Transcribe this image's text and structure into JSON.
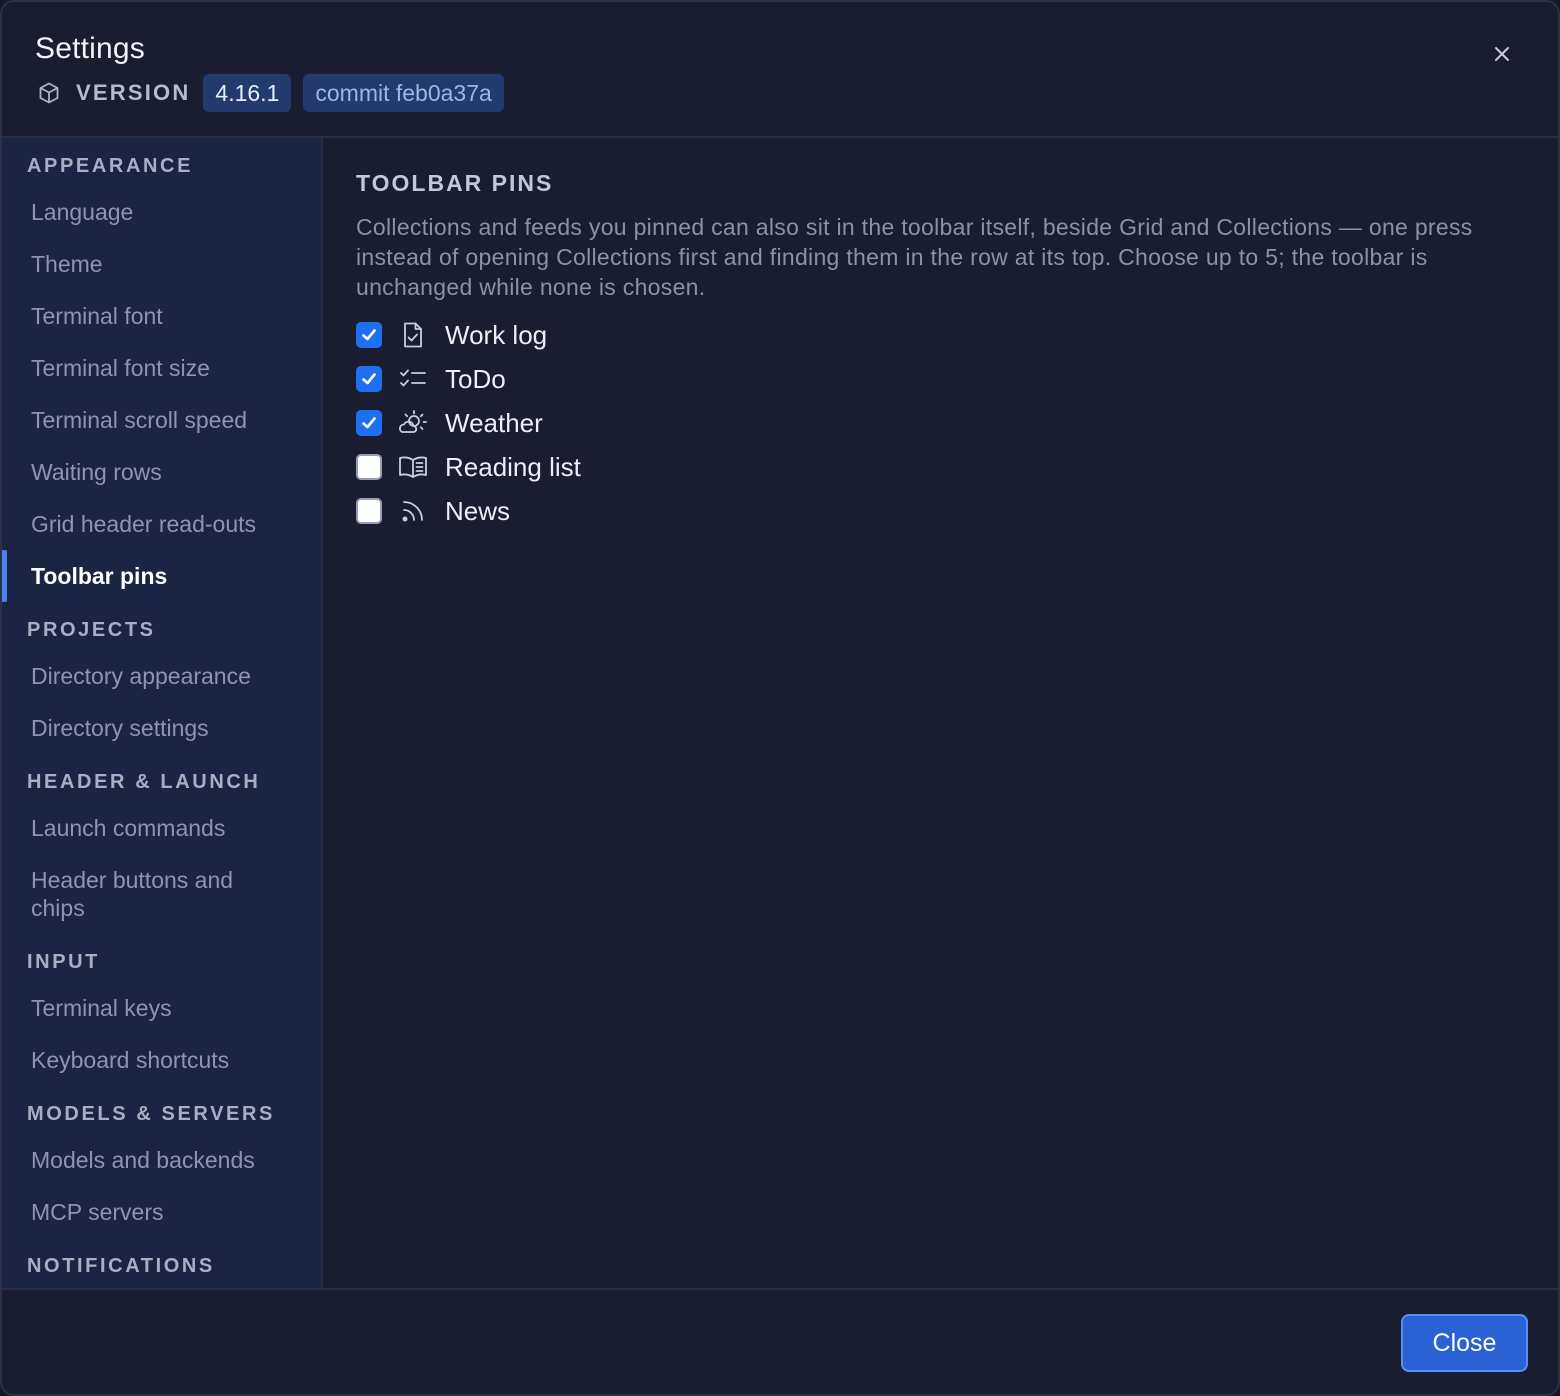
{
  "header": {
    "title": "Settings",
    "version_label": "VERSION",
    "version_chip": "4.16.1",
    "commit_chip": "commit feb0a37a"
  },
  "sidebar": {
    "sections": [
      {
        "header": "APPEARANCE",
        "items": [
          "Language",
          "Theme",
          "Terminal font",
          "Terminal font size",
          "Terminal scroll speed",
          "Waiting rows",
          "Grid header read-outs",
          "Toolbar pins"
        ]
      },
      {
        "header": "PROJECTS",
        "items": [
          "Directory appearance",
          "Directory settings"
        ]
      },
      {
        "header": "HEADER & LAUNCH",
        "items": [
          "Launch commands",
          "Header buttons and chips"
        ]
      },
      {
        "header": "INPUT",
        "items": [
          "Terminal keys",
          "Keyboard shortcuts"
        ]
      },
      {
        "header": "MODELS & SERVERS",
        "items": [
          "Models and backends",
          "MCP servers"
        ]
      },
      {
        "header": "NOTIFICATIONS",
        "items": []
      }
    ],
    "active_item": "Toolbar pins"
  },
  "main": {
    "title": "TOOLBAR PINS",
    "description": "Collections and feeds you pinned can also sit in the toolbar itself, beside Grid and Collections — one press instead of opening Collections first and finding them in the row at its top. Choose up to 5; the toolbar is unchanged while none is chosen.",
    "pins": [
      {
        "label": "Work log",
        "checked": true,
        "icon": "document-check-icon"
      },
      {
        "label": "ToDo",
        "checked": true,
        "icon": "checklist-icon"
      },
      {
        "label": "Weather",
        "checked": true,
        "icon": "sun-cloud-icon"
      },
      {
        "label": "Reading list",
        "checked": false,
        "icon": "open-book-icon"
      },
      {
        "label": "News",
        "checked": false,
        "icon": "rss-icon"
      }
    ]
  },
  "footer": {
    "close_label": "Close"
  },
  "colors": {
    "accent": "#2a62d6",
    "checkbox_checked": "#1f6ff2",
    "chip_background": "#223a6d",
    "sidebar_background": "#1b2442",
    "dialog_background": "#1a1c2f"
  }
}
